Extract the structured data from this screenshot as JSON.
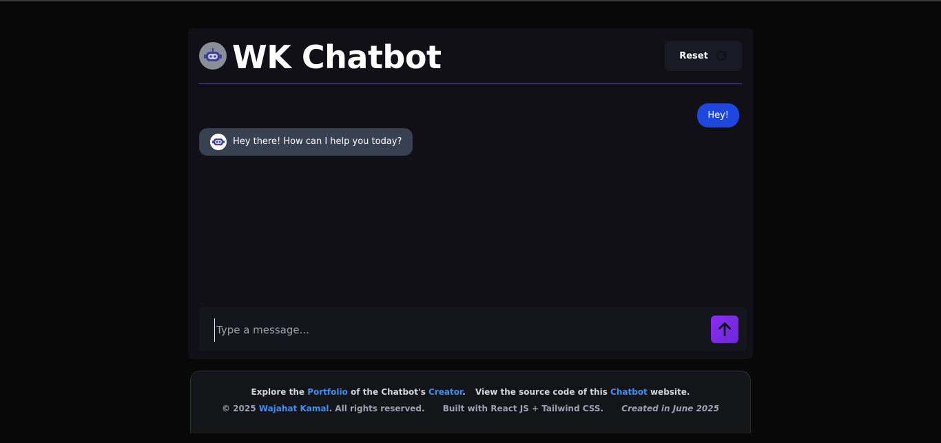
{
  "header": {
    "title": "WK Chatbot",
    "logo_icon": "robot-icon",
    "reset_label": "Reset",
    "reset_icon": "refresh-icon"
  },
  "messages": [
    {
      "role": "user",
      "text": "Hey!"
    },
    {
      "role": "bot",
      "text": "Hey there! How can I help you today?",
      "avatar_icon": "robot-icon"
    }
  ],
  "input": {
    "value": "",
    "placeholder": "Type a message...",
    "send_icon": "arrow-up-icon"
  },
  "footer": {
    "row1": {
      "t1": "Explore the ",
      "link_portfolio": "Portfolio",
      "t2": " of the Chatbot's ",
      "link_creator": "Creator",
      "t3": ".",
      "t4": "View the source code of this ",
      "link_chatbot": "Chatbot",
      "t5": " website."
    },
    "row2": {
      "t1": "© 2025 ",
      "link_author": "Wajahat Kamal",
      "t2": ". All rights reserved.",
      "built_with": "Built with React JS + Tailwind CSS.",
      "created": "Created in June 2025"
    }
  },
  "colors": {
    "background": "#080808",
    "card": "#101016",
    "user_bubble": "#1e47e0",
    "bot_bubble": "#374151",
    "accent_purple": "#8b2cf5",
    "link_blue": "#3b8ff5",
    "divider": "#4b3aa8"
  }
}
